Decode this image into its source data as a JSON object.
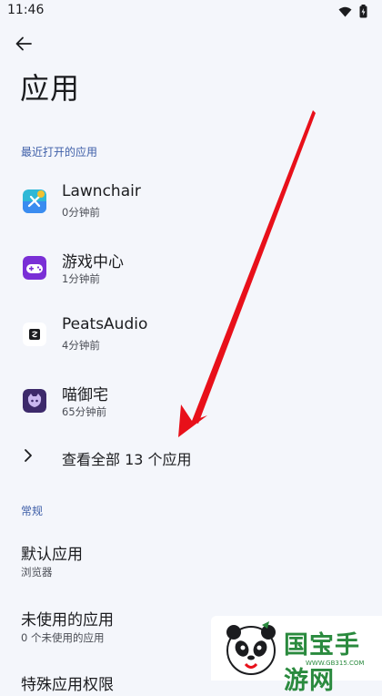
{
  "status_bar": {
    "time": "11:46"
  },
  "page": {
    "title": "应用"
  },
  "recent": {
    "header": "最近打开的应用",
    "apps": [
      {
        "name": "Lawnchair",
        "time": "0分钟前"
      },
      {
        "name": "游戏中心",
        "time": "1分钟前"
      },
      {
        "name": "PeatsAudio",
        "time": "4分钟前"
      },
      {
        "name": "喵御宅",
        "time": "65分钟前"
      }
    ],
    "see_all": "查看全部 13 个应用"
  },
  "general": {
    "header": "常规",
    "items": [
      {
        "title": "默认应用",
        "subtitle": "浏览器"
      },
      {
        "title": "未使用的应用",
        "subtitle": "0 个未使用的应用"
      }
    ],
    "partial_title": "特殊应用权限"
  },
  "watermark": {
    "text": "国宝手游网",
    "url": "WWW.GB315.COM"
  },
  "colors": {
    "background": "#f4f6fb",
    "accent": "#3e5fa8",
    "annotation_arrow": "#e8101a"
  }
}
